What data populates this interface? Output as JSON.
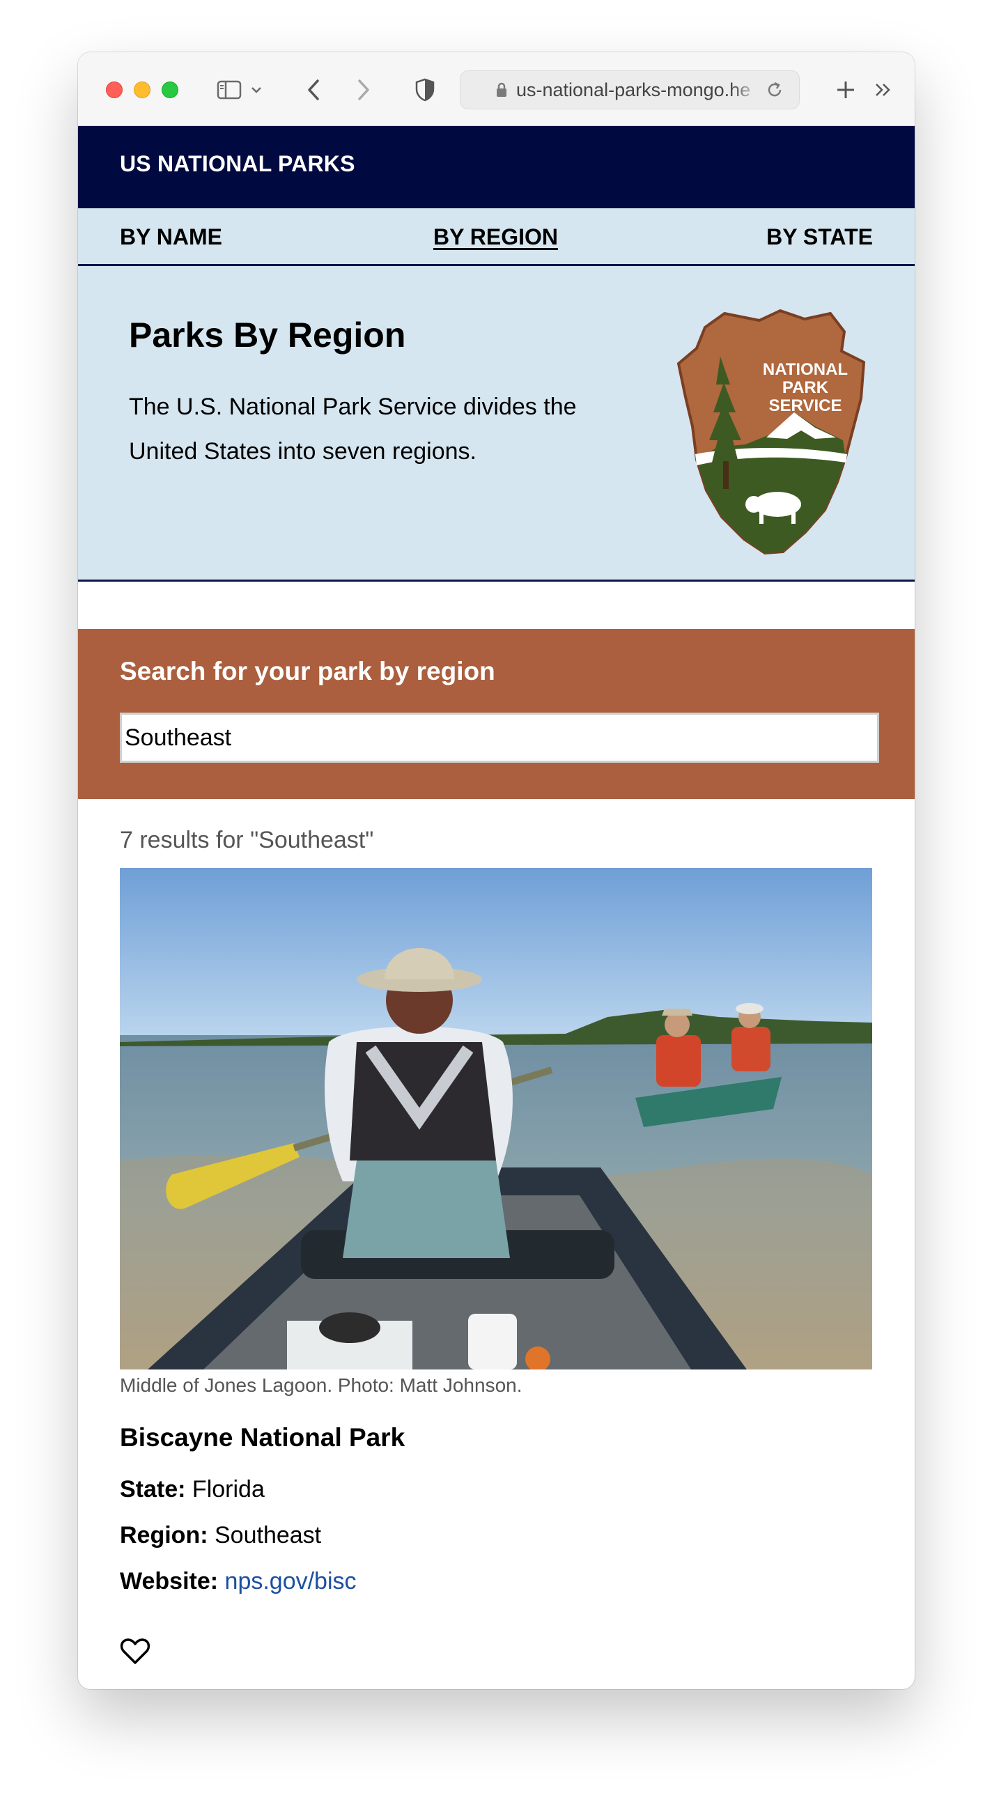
{
  "browser": {
    "url": "us-national-parks-mongo.he",
    "controls": {
      "sidebar_icon": "sidebar-icon",
      "back_icon": "chevron-left-icon",
      "forward_icon": "chevron-right-icon",
      "privacy_icon": "shield-icon",
      "lock_icon": "lock-icon",
      "reload_icon": "reload-icon",
      "new_tab_icon": "plus-icon",
      "overflow_icon": "double-chevron-icon"
    }
  },
  "site": {
    "title": "US NATIONAL PARKS",
    "nav": {
      "by_name": "BY NAME",
      "by_region": "BY REGION",
      "by_state": "BY STATE"
    }
  },
  "hero": {
    "title": "Parks By Region",
    "description": "The U.S. National Park Service divides the United States into seven regions.",
    "logo_text": [
      "NATIONAL",
      "PARK",
      "SERVICE"
    ]
  },
  "search": {
    "label": "Search for your park by region",
    "value": "Southeast"
  },
  "results": {
    "count_text": "7 results for \"Southeast\"",
    "items": [
      {
        "photo_caption": "Middle of Jones Lagoon. Photo: Matt Johnson.",
        "name": "Biscayne National Park",
        "state_label": "State:",
        "state": "Florida",
        "region_label": "Region:",
        "region": "Southeast",
        "website_label": "Website:",
        "website": "nps.gov/bisc",
        "favorite_icon": "heart-outline-icon"
      }
    ]
  },
  "colors": {
    "header_bg": "#010a40",
    "nav_bg": "#d6e6f0",
    "search_bg": "#ab5f3e",
    "link": "#1c4fa0"
  }
}
